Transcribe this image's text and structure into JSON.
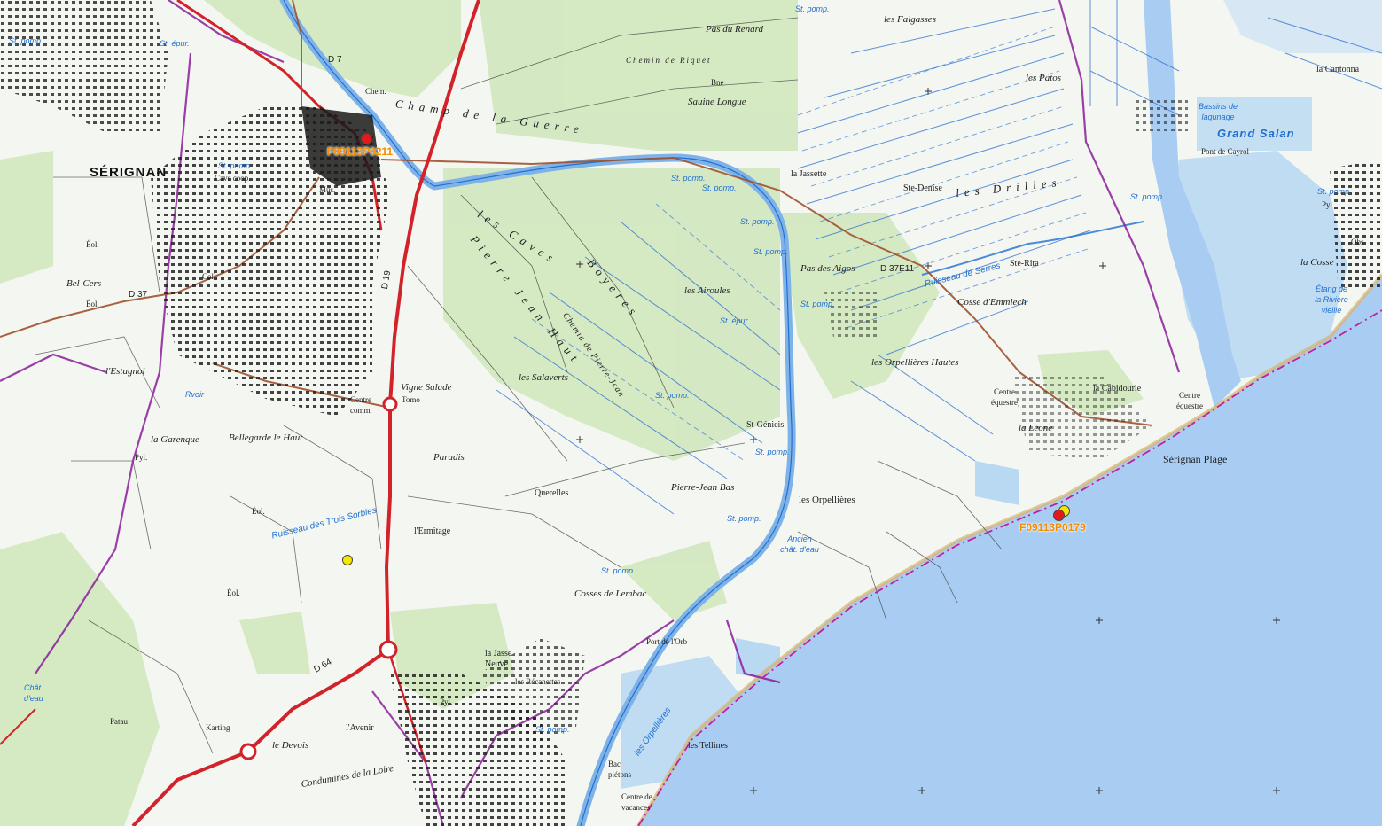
{
  "colors": {
    "sea": "#a9cdf2",
    "vegetation": "#c9e3b4",
    "river": "#7fb3e8",
    "water_line": "#1f6fd1",
    "road_main": "#d3232a",
    "road_secondary": "#a0522d",
    "boundary": "#8a1f9a",
    "marker_red": "#e31a1c",
    "marker_yellow": "#f3e600",
    "ref_label": "#f28c00"
  },
  "markers": [
    {
      "id": "F09113P0211",
      "label": "F09113P0211",
      "color": "red"
    },
    {
      "id": "F09113P0179",
      "label": "F09113P0179",
      "color": "red"
    },
    {
      "id": "yellow-1",
      "label": "",
      "color": "yellow"
    },
    {
      "id": "yellow-2",
      "label": "",
      "color": "yellow"
    }
  ],
  "labels": {
    "serignan": "SÉRIGNAN",
    "serignan_plage": "Sérignan Plage",
    "pas_du_renard": "Pas du Renard",
    "chemin_de_riquet": "Chemin de Riquet",
    "bne": "Bne",
    "sauine_longue": "Sauine Longue",
    "champ_de_la_guerre": "Champ de la Guerre",
    "les_falgasses": "les Falgasses",
    "les_patos": "les Patos",
    "ste_denise": "Ste-Denise",
    "les_drilles": "les Drilles",
    "la_jassette": "la Jassette",
    "ste_rita": "Ste-Rita",
    "cosse_demmiech": "Cosse d'Emmiech",
    "pas_des_aigos": "Pas des Aigos",
    "ruisseau_de_serres": "Ruisseau de Serres",
    "les_orpellieres_hautes": "les Orpellières Hautes",
    "la_cabidourle": "la Cabidourle",
    "centre_equestre": "Centre équestre",
    "la_leone": "la Léone",
    "centre_equestre_2": "Centre équestre",
    "les_caves": "les Caves",
    "boyeres": "Boyeres",
    "pierre_jean_haut": "Pierre Jean Haut",
    "chemin_de_pierre_jean": "Chemin de Pierre-Jean",
    "les_airoules": "les Airoules",
    "les_salaverts": "les Salaverts",
    "st_genieis": "St-Génieis",
    "pierre_jean_bas": "Pierre-Jean Bas",
    "les_orpellieres": "les Orpellières",
    "ancien_chat_deau": "Ancien chât. d'eau",
    "cosses_de_lembac": "Cosses de Lembac",
    "querelles": "Querelles",
    "vigne_salade": "Vigne Salade",
    "tomo": "Tomo",
    "paradis": "Paradis",
    "lermitage": "l'Ermitage",
    "bellegarde_le_haut": "Bellegarde le Haut",
    "la_garenque": "la Garenque",
    "lestagnol": "l'Estagnol",
    "bel_cers": "Bel-Cers",
    "eol_1": "Éol.",
    "eol_2": "Éol.",
    "eol_3": "Éol.",
    "eol_4": "Éol.",
    "ruisseau_des_trois_sorbies": "Ruisseau des Trois Sorbies",
    "port_de_lorb": "Port de l'Orb",
    "la_jasse_neuve": "la Jasse Neuve",
    "les_recanettes": "les Récanettes",
    "les_tellines": "les Tellines",
    "bac_pietons": "Bac piétons",
    "centre_de_vacances": "Centre de vacances",
    "lavenir": "l'Avenir",
    "le_devois": "le Devois",
    "condumines_de_la_loire": "Condumines de la Loire",
    "karting": "Karting",
    "patau": "Patau",
    "grand_salan": "Grand Salan",
    "bassins_de_lagunage": "Bassins de lagunage",
    "pont_de_cayrol": "Pont de Cayrol",
    "la_cosse": "la Cosse",
    "etang_de_la_riviere_vieille": "Étang de la Rivière vieille",
    "obs": "Obs",
    "la_cantonnade": "la Cantonna",
    "st_pomp": "St. pomp.",
    "st_epur": "St. épur.",
    "cave_coop": "Cave coop.",
    "chem": "Chem.",
    "mus": "Mus.",
    "coll": "Coll.",
    "centre_comm": "Centre comm.",
    "pyl": "Pyl.",
    "d37": "D 37",
    "d37e11": "D 37E11",
    "d19": "D 19",
    "d64": "D 64",
    "d7": "D 7",
    "les_orpellieres_canal": "les Orpellières",
    "rvoir": "Rvoir",
    "chateau_deau": "Chât. d'eau"
  }
}
